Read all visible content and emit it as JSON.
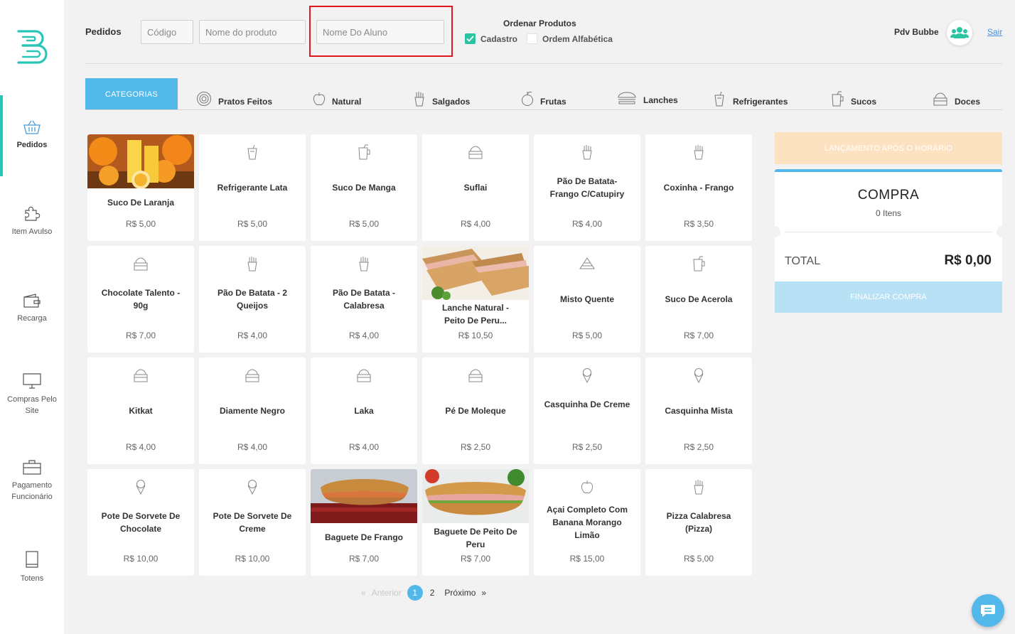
{
  "sidebar": {
    "items": [
      {
        "label": "Pedidos",
        "icon": "basket-icon"
      },
      {
        "label": "Item Avulso",
        "icon": "puzzle-icon"
      },
      {
        "label": "Recarga",
        "icon": "wallet-icon"
      },
      {
        "label": "Compras Pelo Site",
        "icon": "monitor-icon"
      },
      {
        "label": "Pagamento Funcionário",
        "icon": "briefcase-icon"
      },
      {
        "label": "Totens",
        "icon": "tablet-icon"
      }
    ]
  },
  "header": {
    "title": "Pedidos",
    "code_placeholder": "Código",
    "product_placeholder": "Nome do produto",
    "student_placeholder": "Nome Do Aluno",
    "order_title": "Ordenar Produtos",
    "order_options": [
      {
        "label": "Cadastro",
        "checked": true
      },
      {
        "label": "Ordem Alfabética",
        "checked": false
      }
    ],
    "store_name": "Pdv Bubbe",
    "logout": "Sair"
  },
  "categories": {
    "active_label": "CATEGORIAS",
    "tabs": [
      {
        "label": "Pratos Feitos",
        "icon": "plate-icon"
      },
      {
        "label": "Natural",
        "icon": "apple-icon"
      },
      {
        "label": "Salgados",
        "icon": "fries-icon"
      },
      {
        "label": "Frutas",
        "icon": "fruit-icon"
      },
      {
        "label": "Lanches",
        "icon": "burger-icon"
      },
      {
        "label": "Refrigerantes",
        "icon": "soda-icon"
      },
      {
        "label": "Sucos",
        "icon": "juice-icon"
      },
      {
        "label": "Doces",
        "icon": "cake-icon"
      }
    ]
  },
  "products": [
    {
      "name": "Suco De Laranja",
      "price": "R$ 5,00",
      "image": "orange-juice-photo"
    },
    {
      "name": "Refrigerante Lata",
      "price": "R$ 5,00",
      "icon": "soda-icon"
    },
    {
      "name": "Suco De Manga",
      "price": "R$ 5,00",
      "icon": "juice-icon"
    },
    {
      "name": "Suflai",
      "price": "R$ 4,00",
      "icon": "cake-icon"
    },
    {
      "name": "Pão De Batata- Frango C/Catupiry",
      "price": "R$ 4,00",
      "icon": "fries-icon"
    },
    {
      "name": "Coxinha - Frango",
      "price": "R$ 3,50",
      "icon": "fries-icon"
    },
    {
      "name": "Chocolate Talento - 90g",
      "price": "R$ 7,00",
      "icon": "cake-icon"
    },
    {
      "name": "Pão De Batata - 2 Queijos",
      "price": "R$ 4,00",
      "icon": "fries-icon"
    },
    {
      "name": "Pão De Batata - Calabresa",
      "price": "R$ 4,00",
      "icon": "fries-icon"
    },
    {
      "name": "Lanche Natural - Peito De Peru...",
      "price": "R$ 10,50",
      "image": "sandwich-photo"
    },
    {
      "name": "Misto Quente",
      "price": "R$ 5,00",
      "icon": "sandwich-icon"
    },
    {
      "name": "Suco De Acerola",
      "price": "R$ 7,00",
      "icon": "juice-icon"
    },
    {
      "name": "Kitkat",
      "price": "R$ 4,00",
      "icon": "cake-icon"
    },
    {
      "name": "Diamente Negro",
      "price": "R$ 4,00",
      "icon": "cake-icon"
    },
    {
      "name": "Laka",
      "price": "R$ 4,00",
      "icon": "cake-icon"
    },
    {
      "name": "Pé De Moleque",
      "price": "R$ 2,50",
      "icon": "cake-icon"
    },
    {
      "name": "Casquinha De Creme",
      "price": "R$ 2,50",
      "icon": "icecream-icon"
    },
    {
      "name": "Casquinha Mista",
      "price": "R$ 2,50",
      "icon": "icecream-icon"
    },
    {
      "name": "Pote De Sorvete De Chocolate",
      "price": "R$ 10,00",
      "icon": "icecream-icon"
    },
    {
      "name": "Pote De Sorvete De Creme",
      "price": "R$ 10,00",
      "icon": "icecream-icon"
    },
    {
      "name": "Baguete De Frango",
      "price": "R$ 7,00",
      "image": "baguette-photo"
    },
    {
      "name": "Baguete De Peito De Peru",
      "price": "R$ 7,00",
      "image": "baguette-photo-2"
    },
    {
      "name": "Açai Completo Com Banana Morango Limão",
      "price": "R$ 15,00",
      "icon": "apple-icon"
    },
    {
      "name": "Pizza Calabresa (Pizza)",
      "price": "R$ 5,00",
      "icon": "fries-icon"
    }
  ],
  "pagination": {
    "prev": "Anterior",
    "pages": [
      "1",
      "2"
    ],
    "current": "1",
    "next": "Próximo"
  },
  "cart": {
    "late_notice": "LANÇAMENTO APÓS O HORÁRIO",
    "title": "COMPRA",
    "count": "0 Itens",
    "total_label": "TOTAL",
    "total_value": "R$ 0,00",
    "finish_label": "FINALIZAR COMPRA"
  },
  "colors": {
    "accent": "#52b8ea",
    "teal": "#29c6b8",
    "check": "#2cc3a2",
    "highlight": "#e0161f"
  }
}
